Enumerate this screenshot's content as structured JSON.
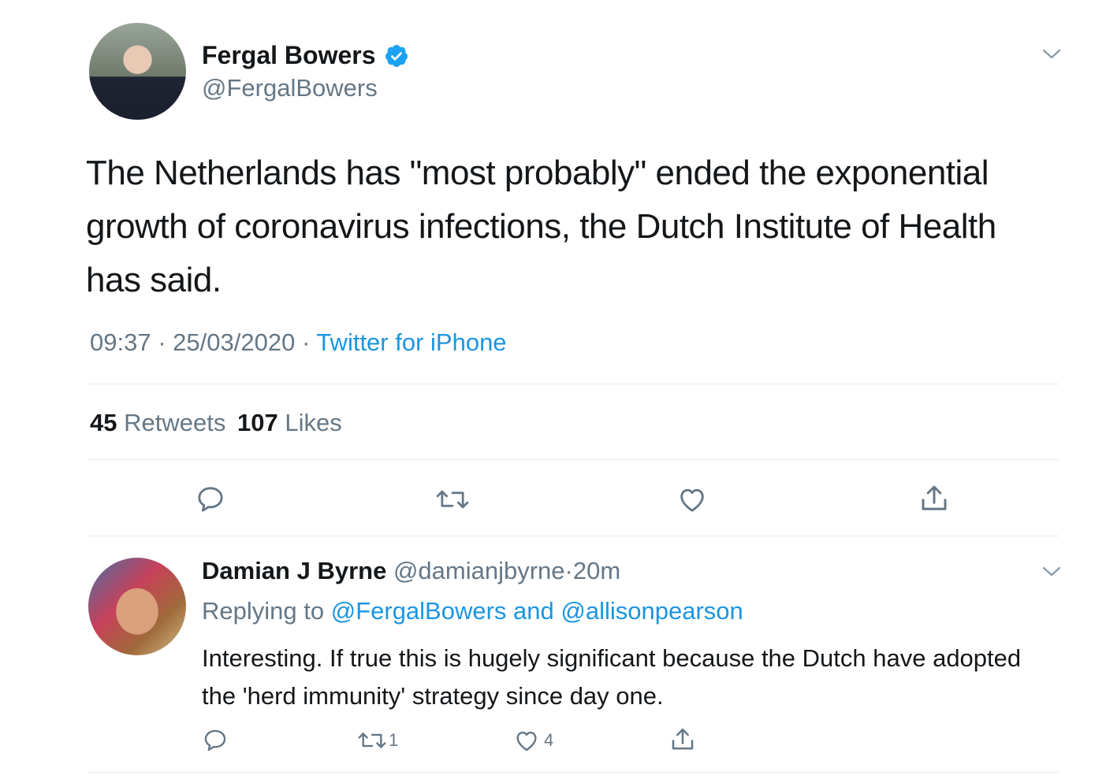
{
  "main_tweet": {
    "author_name": "Fergal Bowers",
    "handle": "@FergalBowers",
    "text": "The Netherlands has \"most probably\" ended the exponential growth of coronavirus infections, the Dutch Institute of Health has said.",
    "time": "09:37",
    "date": "25/03/2020",
    "separator": "·",
    "source": "Twitter for iPhone",
    "stats": {
      "retweets_count": "45",
      "retweets_label": "Retweets",
      "likes_count": "107",
      "likes_label": "Likes"
    },
    "actions": [
      "reply-icon",
      "retweet-icon",
      "like-icon",
      "share-icon"
    ]
  },
  "reply": {
    "author_name": "Damian J Byrne",
    "handle": "@damianjbyrne",
    "separator": "·",
    "time_ago": "20m",
    "replying_to_label": "Replying to",
    "replying_to_users": "@FergalBowers and @allisonpearson",
    "text": "Interesting. If true this is hugely significant because the Dutch have adopted the 'herd immunity' strategy since day one.",
    "retweet_count": "1",
    "like_count": "4"
  },
  "colors": {
    "link": "#1b95e0",
    "muted": "#657786",
    "text": "#14171a",
    "divider": "#e1e8ed",
    "verified": "#1da1f2"
  }
}
